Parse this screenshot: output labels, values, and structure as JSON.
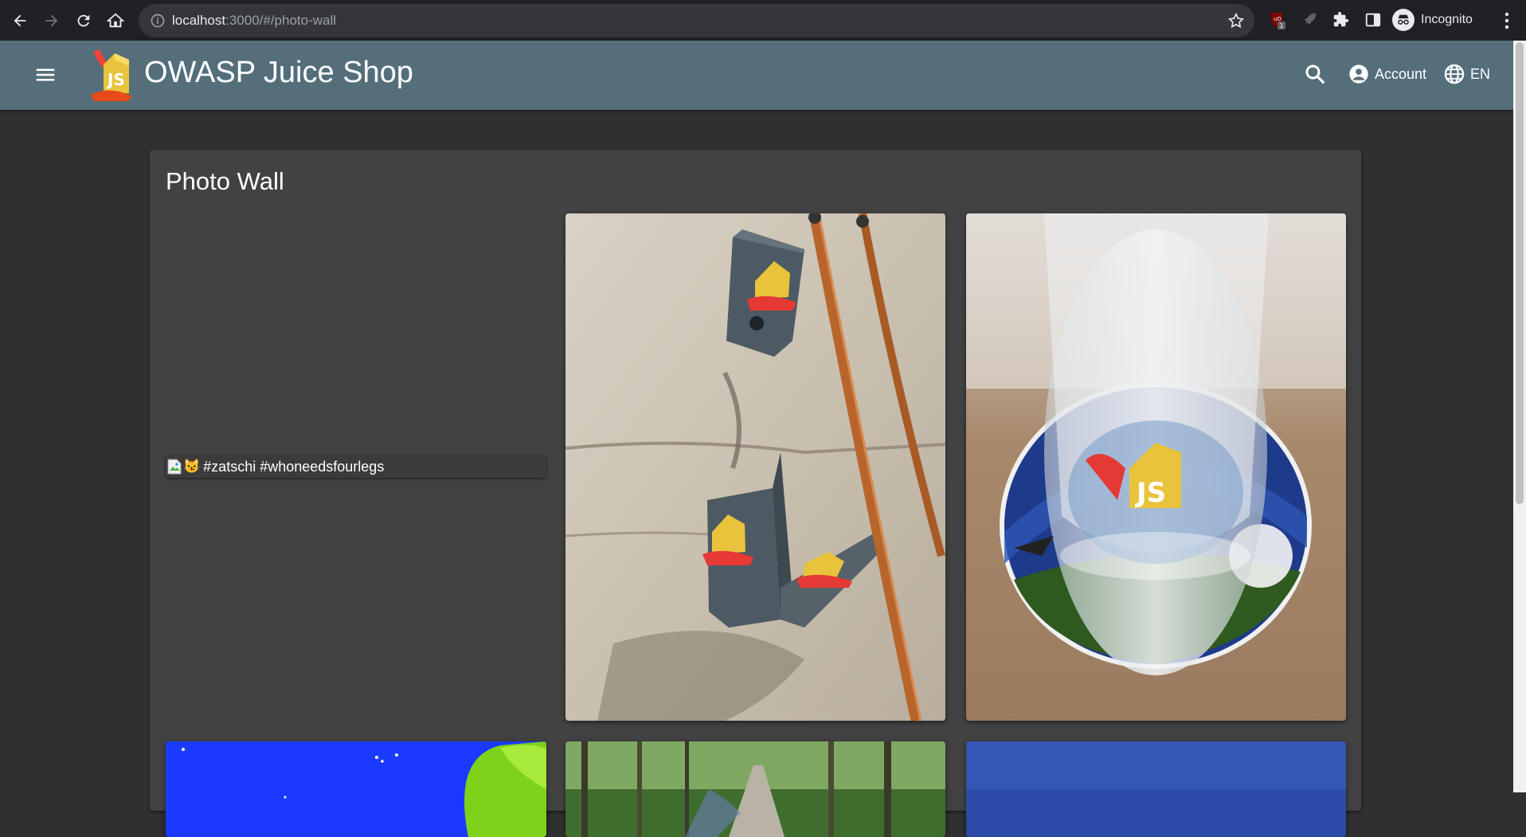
{
  "browser": {
    "url_host": "localhost",
    "url_path": ":3000/#/photo-wall",
    "profile_label": "Incognito",
    "ublock_badge": "1"
  },
  "app": {
    "title": "OWASP Juice Shop",
    "account_label": "Account",
    "language_label": "EN",
    "toolbar_color": "#546e7a"
  },
  "photo_wall": {
    "title": "Photo Wall",
    "items": [
      {
        "caption": "#zatschi #whoneedsfourlegs",
        "emoji": "😼",
        "image": "broken"
      },
      {
        "image": "stickers-on-stone-wall"
      },
      {
        "image": "glass-on-coaster"
      },
      {
        "image": "blue-sky-green-hill"
      },
      {
        "image": "forest-path"
      },
      {
        "image": "blue-photo"
      }
    ]
  }
}
